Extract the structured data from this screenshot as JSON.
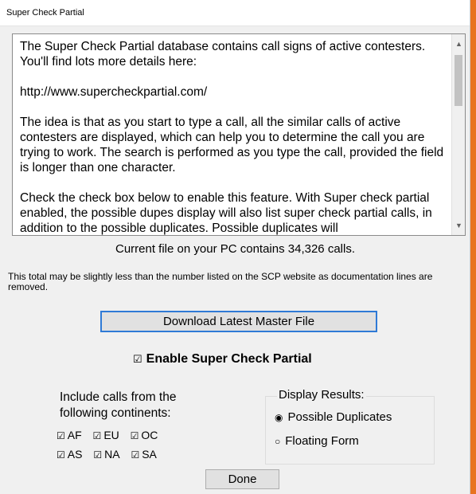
{
  "window": {
    "title": "Super Check Partial"
  },
  "description": {
    "paragraphs": [
      "The Super Check Partial database contains call signs of active contesters.  You'll find lots more details here:",
      "http://www.supercheckpartial.com/",
      "The idea is that as you start to type a call, all the similar calls of active contesters are displayed, which can help you to determine the call you are trying to work. The search is performed as you type the call, provided the field is longer than one character.",
      "Check the check box below to enable this feature.  With Super check partial enabled, the possible dupes display will also list super check partial calls, in addition to the possible duplicates.  Possible duplicates will"
    ]
  },
  "current_file": "Current file on your PC contains 34,326 calls.",
  "note": "This total may be slightly less than the number listed on the SCP website as documentation lines are removed.",
  "download_button": "Download Latest Master File",
  "enable_label": "Enable Super Check Partial",
  "enable_checked": true,
  "continents": {
    "label_line1": "Include calls from the",
    "label_line2": "following continents:",
    "items": [
      {
        "code": "AF",
        "checked": true
      },
      {
        "code": "EU",
        "checked": true
      },
      {
        "code": "OC",
        "checked": true
      },
      {
        "code": "AS",
        "checked": true
      },
      {
        "code": "NA",
        "checked": true
      },
      {
        "code": "SA",
        "checked": true
      }
    ]
  },
  "display_results": {
    "legend": "Display Results:",
    "options": [
      {
        "label": "Possible Duplicates",
        "selected": true
      },
      {
        "label": "Floating Form",
        "selected": false
      }
    ]
  },
  "done_button": "Done",
  "icons": {
    "checkbox_checked": "☑",
    "radio_selected": "◉",
    "radio_unselected": "○",
    "scroll_up": "▲",
    "scroll_down": "▼"
  }
}
